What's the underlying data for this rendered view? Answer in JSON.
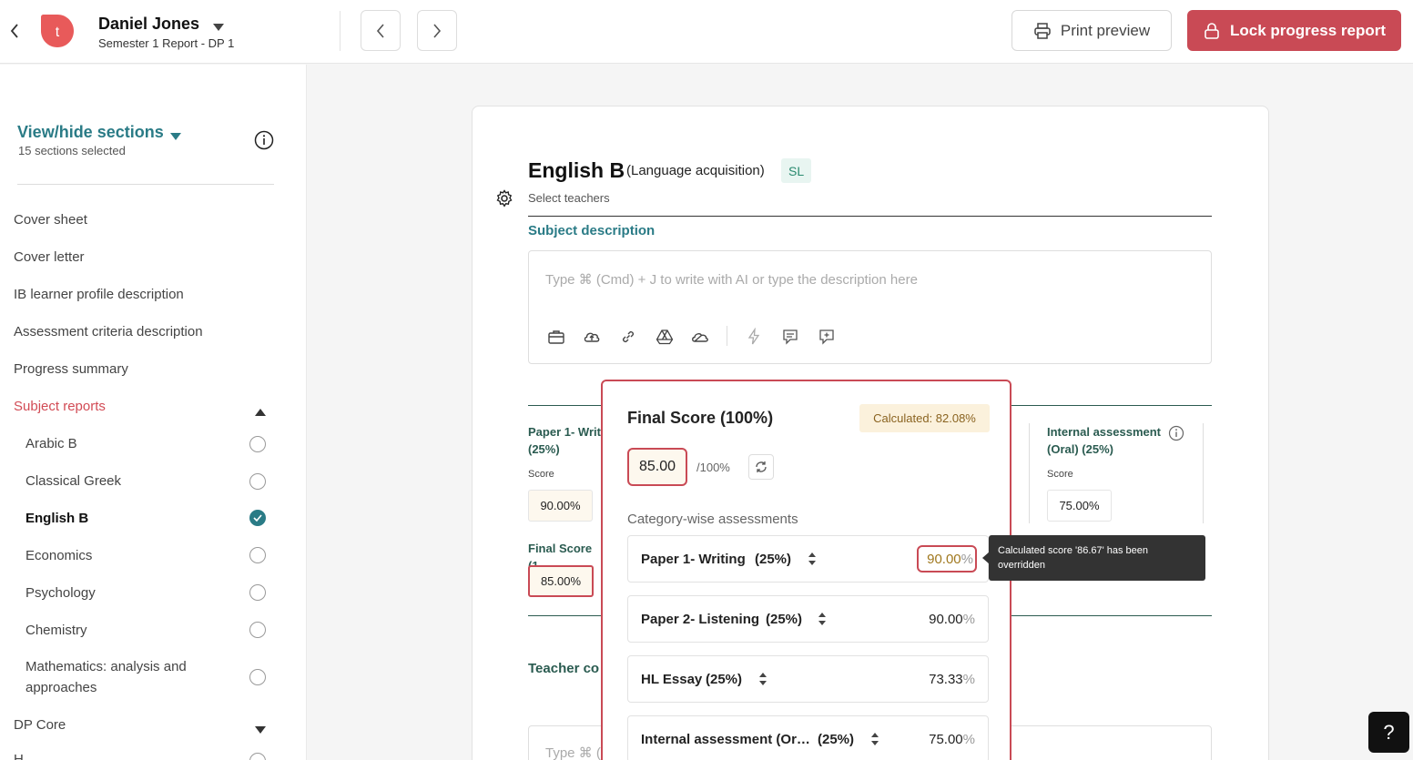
{
  "header": {
    "user_name": "Daniel Jones",
    "report_sub": "Semester 1 Report - DP 1",
    "logo_letter": "t",
    "print_label": "Print preview",
    "lock_label": "Lock progress report"
  },
  "sidebar": {
    "view_hide": "View/hide sections",
    "sections_selected": "15 sections selected",
    "items": [
      "Cover sheet",
      "Cover letter",
      "IB learner profile description",
      "Assessment criteria description",
      "Progress summary"
    ],
    "subject_reports": "Subject reports",
    "subjects": [
      "Arabic B",
      "Classical Greek",
      "English B",
      "Economics",
      "Psychology",
      "Chemistry",
      "Mathematics: analysis and",
      "approaches"
    ],
    "dp_core": "DP Core",
    "last_item_partial": "H"
  },
  "subject": {
    "name": "English B",
    "group": "(Language acquisition)",
    "level": "SL",
    "select_teachers": "Select teachers",
    "desc_heading": "Subject description",
    "desc_placeholder": "Type ⌘ (Cmd) + J to write with AI or type the description here",
    "paper1_label": "Paper 1- Writ",
    "paper1_weight": "(25%)",
    "score_label": "Score",
    "paper1_score": "90.00%",
    "final_score_label": "Final Score (1",
    "final_score_value": "85.00%",
    "ia_label": "Internal assessment",
    "ia_label2": "(Oral) (25%)",
    "ia_score": "75.00%",
    "teacher_comment_partial": "Teacher co",
    "comment_placeholder_partial": "Type ⌘ ("
  },
  "popover": {
    "title": "Final Score (100%)",
    "calculated": "Calculated: 82.08%",
    "final_value": "85.00",
    "max": "/100%",
    "category_title": "Category-wise assessments",
    "categories": [
      {
        "name": "Paper 1- Writing",
        "weight": "(25%)",
        "value": "90.00",
        "unit": "%"
      },
      {
        "name": "Paper 2- Listening",
        "weight": "(25%)",
        "value": "90.00",
        "unit": "%"
      },
      {
        "name": "HL Essay",
        "weight": "(25%)",
        "value": "73.33",
        "unit": "%"
      },
      {
        "name": "Internal assessment (Or…",
        "weight": "(25%)",
        "value": "75.00",
        "unit": "%"
      }
    ]
  },
  "tooltip": {
    "text": "Calculated score '86.67' has been overridden"
  },
  "help": "?",
  "colors": {
    "accent_teal": "#2a7b86",
    "brand_red": "#c94a55",
    "logo_red": "#e85a5a"
  }
}
